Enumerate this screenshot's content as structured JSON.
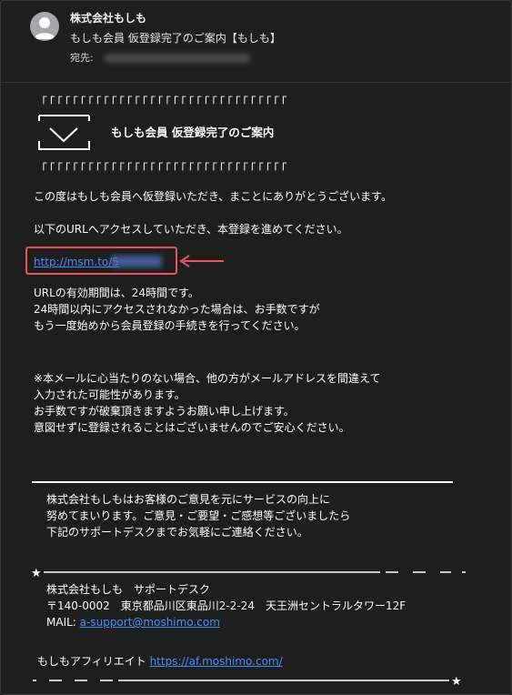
{
  "header": {
    "sender": "株式会社もしも",
    "subject": "もしも会員 仮登録完了のご案内【もしも】",
    "to_label": "宛先:"
  },
  "banner": {
    "brackets": "「「「「「「「「「「「「「「「「「「「「「「「「「「「「「「「「",
    "title": "もしも会員 仮登録完了のご案内"
  },
  "body": {
    "p1": "この度はもしも会員へ仮登録いただき、まことにありがとうございます。",
    "p2": "以下のURLへアクセスしていただき、本登録を進めてください。",
    "url": "http://msm.to/5",
    "validity": [
      "URLの有効期間は、24時間です。",
      "24時間以内にアクセスされなかった場合は、お手数ですが",
      "もう一度始めから会員登録の手続きを行ってください。"
    ],
    "notice": [
      "※本メールに心当たりのない場合、他の方がメールアドレスを間違えて",
      "入力された可能性があります。",
      "お手数ですが破棄頂きますようお願い申し上げます。",
      "意図せずに登録されることはございませんのでご安心ください。"
    ]
  },
  "footer": {
    "feedback": [
      "株式会社もしもはお客様のご意見を元にサービスの向上に",
      "努めてまいります。ご意見・ご要望・ご感想等ございましたら",
      "下記のサポートデスクまでお気軽にご連絡ください。"
    ],
    "support_name": "株式会社もしも　サポートデスク",
    "address": "〒140-0002　東京都品川区東品川2-2-24　天王洲セントラルタワー12F",
    "mail_label": "MAIL: ",
    "mail": "a-support@moshimo.com",
    "affiliate_label": "もしもアフィリエイト ",
    "affiliate_url": "https://af.moshimo.com/"
  },
  "colors": {
    "background": "#1e1e1e",
    "link": "#4c8dff",
    "highlight": "#e7555e"
  }
}
